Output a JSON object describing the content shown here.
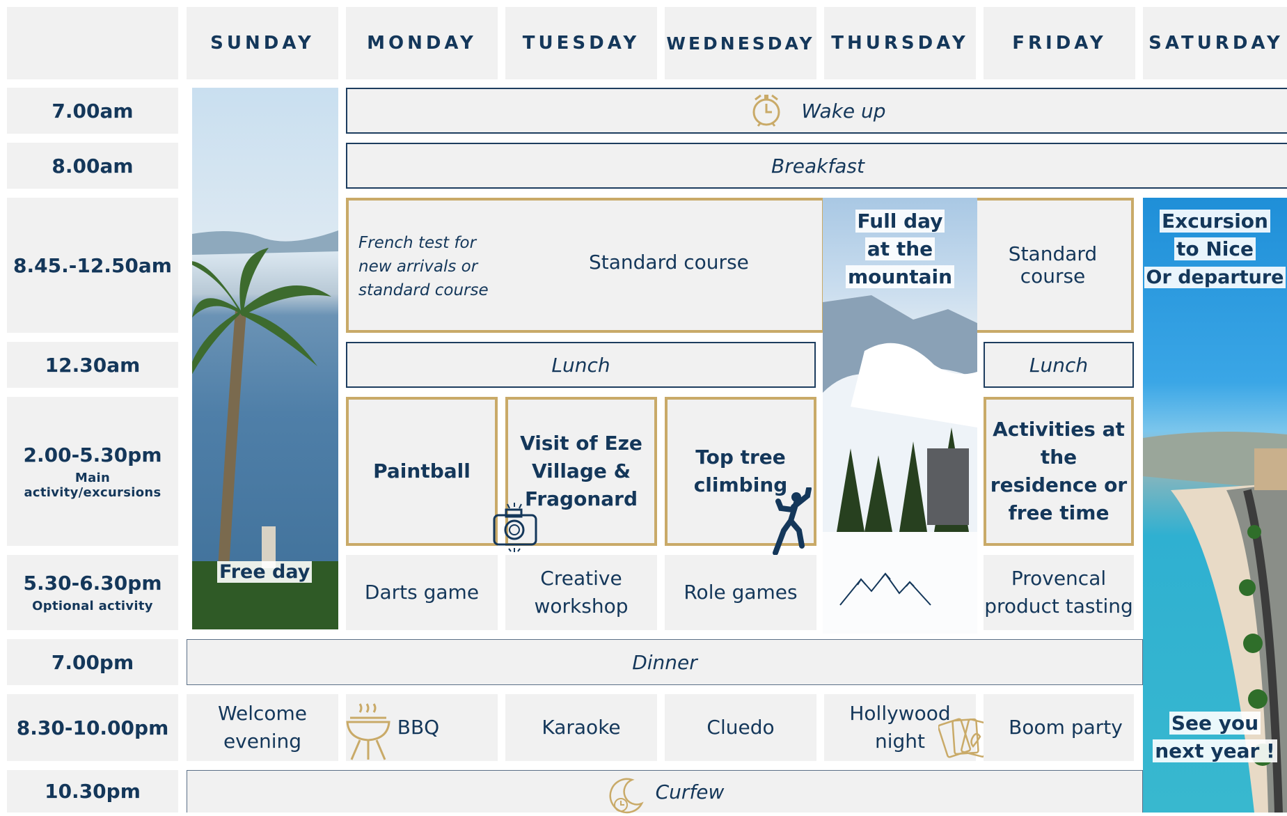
{
  "days": [
    "SUNDAY",
    "MONDAY",
    "TUESDAY",
    "WEDNESDAY",
    "THURSDAY",
    "FRIDAY",
    "SATURDAY"
  ],
  "times": [
    {
      "label": "7.00am",
      "sub": ""
    },
    {
      "label": "8.00am",
      "sub": ""
    },
    {
      "label": "8.45.-12.50am",
      "sub": ""
    },
    {
      "label": "12.30am",
      "sub": ""
    },
    {
      "label": "2.00-5.30pm",
      "sub": "Main activity/excursions"
    },
    {
      "label": "5.30-6.30pm",
      "sub": "Optional activity"
    },
    {
      "label": "7.00pm",
      "sub": ""
    },
    {
      "label": "8.30-10.00pm",
      "sub": ""
    },
    {
      "label": "10.30pm",
      "sub": ""
    }
  ],
  "all_week": {
    "wake_up": "Wake up",
    "breakfast": "Breakfast",
    "dinner": "Dinner",
    "curfew": "Curfew"
  },
  "morning": {
    "french_test": "French test for new arrivals or standard course",
    "standard_course": "Standard course",
    "friday_course": "Standard course"
  },
  "lunch": {
    "mon_wed": "Lunch",
    "fri": "Lunch"
  },
  "afternoon": {
    "monday": "Paintball",
    "tuesday": "Visit of Eze Village & Fragonard",
    "wednesday": "Top tree climbing",
    "friday": "Activities at the residence or free time"
  },
  "optional": {
    "monday": "Darts game",
    "tuesday": "Creative workshop",
    "wednesday": "Role games",
    "friday": "Provencal product tasting"
  },
  "evening": {
    "sunday": "Welcome evening",
    "monday": "BBQ",
    "tuesday": "Karaoke",
    "wednesday": "Cluedo",
    "thursday": "Hollywood night",
    "friday": "Boom party"
  },
  "sunday_photo": {
    "label": "Free day"
  },
  "thursday_photo": {
    "label_lines": [
      "Full day",
      "at the",
      "mountain"
    ]
  },
  "saturday_photo": {
    "label_lines": [
      "Excursion",
      "to Nice",
      "Or departure"
    ],
    "bottom_lines": [
      "See you",
      "next year !"
    ]
  },
  "icons": {
    "alarm": "alarm-clock-icon",
    "camera": "camera-icon",
    "climber": "climber-icon",
    "bbq": "bbq-grill-icon",
    "cards": "playing-cards-icon",
    "moon": "moon-clock-icon",
    "mountains": "mountains-icon"
  },
  "colors": {
    "navy": "#14375a",
    "gold": "#c9aa68",
    "cell": "#f1f1f1"
  }
}
